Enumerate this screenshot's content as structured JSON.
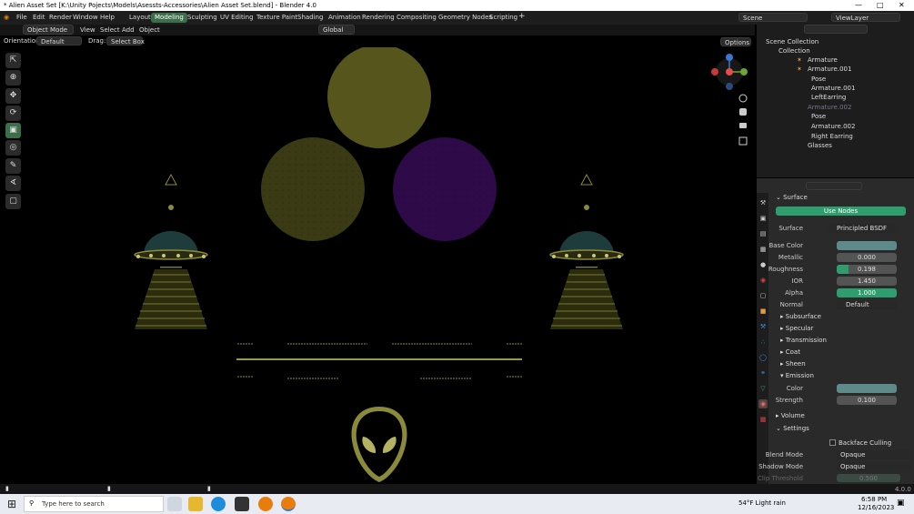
{
  "window": {
    "title": "* Alien Asset Set [K:\\Unity Pojects\\Models\\Asessts-Accessories\\Alien Asset Set.blend] - Blender 4.0"
  },
  "menus": [
    "File",
    "Edit",
    "Render",
    "Window",
    "Help"
  ],
  "workspaces": [
    "Layout",
    "Modeling",
    "Sculpting",
    "UV Editing",
    "Texture Paint",
    "Shading",
    "Animation",
    "Rendering",
    "Compositing",
    "Geometry Nodes",
    "Scripting"
  ],
  "active_workspace": "Modeling",
  "scene": "Scene",
  "view_layer": "ViewLayer",
  "header": {
    "mode": "Object Mode",
    "view": "View",
    "select": "Select",
    "add": "Add",
    "object": "Object",
    "transform": "Global",
    "orientation_label": "Orientation:",
    "orientation": "Default",
    "drag_label": "Drag:",
    "drag": "Select Box",
    "options": "Options"
  },
  "outliner": {
    "items": [
      {
        "label": "Scene Collection",
        "indent": 0
      },
      {
        "label": "Collection",
        "indent": 1
      },
      {
        "label": "Armature",
        "indent": 2
      },
      {
        "label": "Armature.001",
        "indent": 2
      },
      {
        "label": "Pose",
        "indent": 3
      },
      {
        "label": "Armature.001",
        "indent": 3
      },
      {
        "label": "LeftEarring",
        "indent": 3
      },
      {
        "label": "Armature.002",
        "indent": 2
      },
      {
        "label": "Pose",
        "indent": 3
      },
      {
        "label": "Armature.002",
        "indent": 3
      },
      {
        "label": "Right Earring",
        "indent": 3
      },
      {
        "label": "Glasses",
        "indent": 2
      }
    ]
  },
  "properties": {
    "surface_section": "Surface",
    "use_nodes": "Use Nodes",
    "surface_label": "Surface",
    "surface_value": "Principled BSDF",
    "base_color_label": "Base Color",
    "metallic_label": "Metallic",
    "metallic": "0.000",
    "roughness_label": "Roughness",
    "roughness": "0.198",
    "roughness_fill": 0.198,
    "ior_label": "IOR",
    "ior": "1.450",
    "alpha_label": "Alpha",
    "alpha": "1.000",
    "normal_label": "Normal",
    "normal": "Default",
    "subsections": [
      "Subsurface",
      "Specular",
      "Transmission",
      "Coat",
      "Sheen"
    ],
    "emission": "Emission",
    "emission_color_label": "Color",
    "strength_label": "Strength",
    "strength": "0.100",
    "volume": "Volume",
    "settings": "Settings",
    "backface_culling": "Backface Culling",
    "blend_mode_label": "Blend Mode",
    "blend_mode": "Opaque",
    "shadow_mode_label": "Shadow Mode",
    "shadow_mode": "Opaque",
    "clip_label": "Clip Threshold",
    "clip": "0.500"
  },
  "version": "4.0.0",
  "taskbar": {
    "search": "Type here to search",
    "weather": "54°F  Light rain",
    "time": "6:58 PM",
    "date": "12/16/2023"
  },
  "colors": {
    "accent": "#3d6e4a",
    "olive": "#55551c",
    "purple": "#3c0f5a",
    "teal": "#1e3c3c",
    "nodes_green": "#2f9e6e"
  }
}
